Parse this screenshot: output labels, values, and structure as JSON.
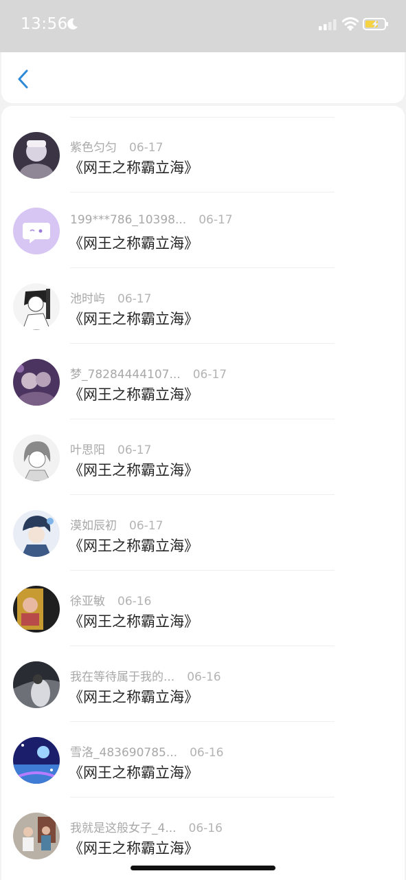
{
  "status_bar": {
    "time": "13:56"
  },
  "items": [
    {
      "name": "紫色匀匀",
      "date": "06-17",
      "title": "《网王之称霸立海》"
    },
    {
      "name": "199***786_10398...",
      "date": "06-17",
      "title": "《网王之称霸立海》"
    },
    {
      "name": "池时屿",
      "date": "06-17",
      "title": "《网王之称霸立海》"
    },
    {
      "name": "梦_78284444107...",
      "date": "06-17",
      "title": "《网王之称霸立海》"
    },
    {
      "name": "叶思阳",
      "date": "06-17",
      "title": "《网王之称霸立海》"
    },
    {
      "name": "漠如辰初",
      "date": "06-17",
      "title": "《网王之称霸立海》"
    },
    {
      "name": "徐亚敏",
      "date": "06-16",
      "title": "《网王之称霸立海》"
    },
    {
      "name": "我在等待属于我的...",
      "date": "06-16",
      "title": "《网王之称霸立海》"
    },
    {
      "name": "雪洛_483690785...",
      "date": "06-16",
      "title": "《网王之称霸立海》"
    },
    {
      "name": "我就是这般女子_4...",
      "date": "06-16",
      "title": "《网王之称霸立海》"
    }
  ]
}
